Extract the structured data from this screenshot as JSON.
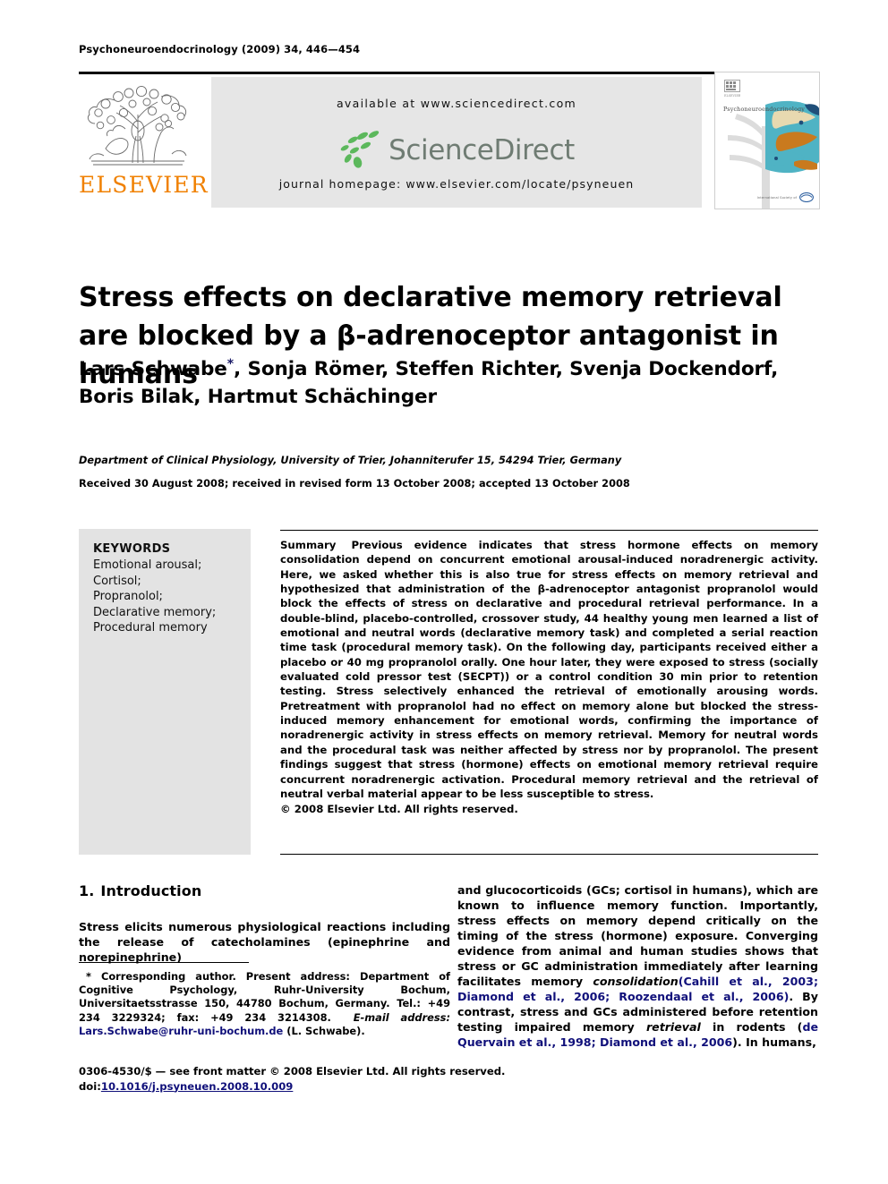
{
  "running_head": "Psychoneuroendocrinology (2009) 34, 446—454",
  "publisher": {
    "logo_wordmark": "ELSEVIER",
    "logo_color": "#f08000",
    "tree_icon": "elsevier-tree-icon"
  },
  "sciencedirect_band": {
    "available_at": "available at www.sciencedirect.com",
    "logo_text": "ScienceDirect",
    "logo_text_color": "#6f7c73",
    "logo_seed_color": "#5cb85c",
    "journal_homepage": "journal homepage: www.elsevier.com/locate/psyneuen",
    "background_color": "#e6e6e6"
  },
  "journal_cover": {
    "journal_name": "Psychoneuroendocrinology",
    "society_label": "International Society of\nPsychoneuroendocrinology",
    "brain_image_colors": [
      "#4fb3c4",
      "#c97a1e",
      "#e8d9b0",
      "#1f4e79"
    ]
  },
  "article": {
    "title": "Stress effects on declarative memory retrieval are blocked by a β-adrenoceptor antagonist in humans",
    "authors_line1": "Lars Schwabe",
    "corresponding_marker": "*",
    "authors_line1_rest": ", Sonja Römer, Steffen Richter, Svenja Dockendorf,",
    "authors_line2": "Boris Bilak, Hartmut Schächinger",
    "affiliation": "Department of Clinical Physiology, University of Trier, Johanniterufer 15, 54294 Trier, Germany",
    "received": "Received 30 August 2008; received in revised form 13 October 2008; accepted 13 October 2008"
  },
  "keywords": {
    "heading": "KEYWORDS",
    "items": [
      "Emotional arousal;",
      "Cortisol;",
      "Propranolol;",
      "Declarative memory;",
      "Procedural memory"
    ],
    "panel_color": "#e3e3e3"
  },
  "abstract": {
    "label": "Summary",
    "body": "Previous evidence indicates that stress hormone effects on memory consolidation depend on concurrent emotional arousal-induced noradrenergic activity. Here, we asked whether this is also true for stress effects on memory retrieval and hypothesized that administration of the β-adrenoceptor antagonist propranolol would block the effects of stress on declarative and procedural retrieval performance. In a double-blind, placebo-controlled, crossover study, 44 healthy young men learned a list of emotional and neutral words (declarative memory task) and completed a serial reaction time task (procedural memory task). On the following day, participants received either a placebo or 40 mg propranolol orally. One hour later, they were exposed to stress (socially evaluated cold pressor test (SECPT)) or a control condition 30 min prior to retention testing. Stress selectively enhanced the retrieval of emotionally arousing words. Pretreatment with propranolol had no effect on memory alone but blocked the stress-induced memory enhancement for emotional words, confirming the importance of noradrenergic activity in stress effects on memory retrieval. Memory for neutral words and the procedural task was neither affected by stress nor by propranolol. The present findings suggest that stress (hormone) effects on emotional memory retrieval require concurrent noradrenergic activation. Procedural memory retrieval and the retrieval of neutral verbal material appear to be less susceptible to stress.",
    "copyright": "© 2008 Elsevier Ltd. All rights reserved."
  },
  "introduction": {
    "number": "1.",
    "heading": "Introduction",
    "left_paragraph": "Stress elicits numerous physiological reactions including the release of catecholamines (epinephrine and norepinephrine)",
    "right_paragraph_part1": "and glucocorticoids (GCs; cortisol in humans), which are known to influence memory function. Importantly, stress effects on memory depend critically on the timing of the stress (hormone) exposure. Converging evidence from animal and human studies shows that stress or GC administration immediately after learning facilitates memory ",
    "right_italic1": "consolidation",
    "right_citation1": "(Cahill et al., 2003; Diamond et al., 2006; Roozendaal et al., 2006)",
    "right_paragraph_part2": ". By contrast, stress and GCs administered before retention testing impaired memory ",
    "right_italic2": "retrieval",
    "right_paragraph_part3": " in rodents (",
    "right_citation2": "de Quervain et al., 1998; Diamond et al., 2006",
    "right_paragraph_part4": "). In humans,"
  },
  "footnote": {
    "marker": "*",
    "text": "Corresponding author. Present address: Department of Cognitive Psychology, Ruhr-University Bochum, Universitaetsstrasse 150, 44780 Bochum, Germany. Tel.: +49 234 3229324; fax: +49 234 3214308.",
    "email_label": "E-mail address:",
    "email": "Lars.Schwabe@ruhr-uni-bochum.de",
    "email_owner": "(L. Schwabe).",
    "link_color": "#10107a"
  },
  "footer": {
    "front_matter": "0306-4530/$ — see front matter © 2008 Elsevier Ltd. All rights reserved.",
    "doi_prefix": "doi:",
    "doi": "10.1016/j.psyneuen.2008.10.009"
  }
}
